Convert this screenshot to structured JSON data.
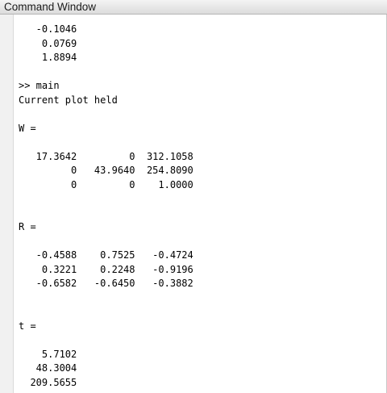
{
  "window": {
    "title": "Command Window"
  },
  "console": {
    "lines": [
      "   -0.1046",
      "    0.0769",
      "    1.8894",
      "",
      ">> main",
      "Current plot held",
      "",
      "W =",
      "",
      "   17.3642         0  312.1058",
      "         0   43.9640  254.8090",
      "         0         0    1.0000",
      "",
      "",
      "R =",
      "",
      "   -0.4588    0.7525   -0.4724",
      "    0.3221    0.2248   -0.9196",
      "   -0.6582   -0.6450   -0.3882",
      "",
      "",
      "t =",
      "",
      "    5.7102",
      "   48.3004",
      "  209.5655"
    ]
  }
}
